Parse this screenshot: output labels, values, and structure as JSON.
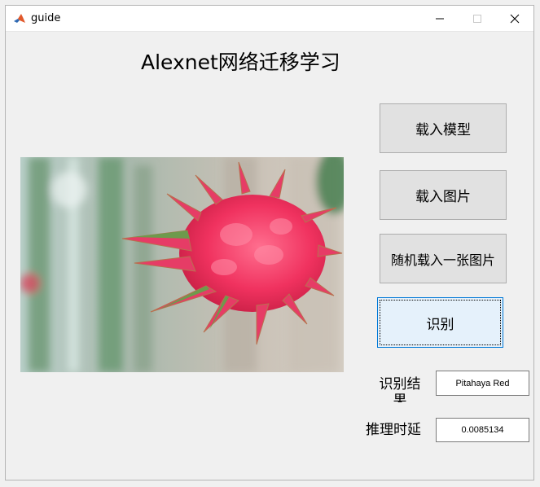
{
  "window": {
    "title": "guide",
    "app_icon": "matlab-icon",
    "controls": [
      "minimize-icon",
      "maximize-icon",
      "close-icon"
    ]
  },
  "main": {
    "heading": "Alexnet网络迁移学习",
    "image_panel": {
      "content": "dragon-fruit-photo"
    },
    "buttons": {
      "load_model": "载入模型",
      "load_image": "载入图片",
      "random_image": "随机载入一张图片",
      "recognize": "识别"
    },
    "result": {
      "label": "识别结果",
      "value": "Pitahaya Red"
    },
    "latency": {
      "label": "推理时延",
      "value": "0.0085134"
    }
  }
}
